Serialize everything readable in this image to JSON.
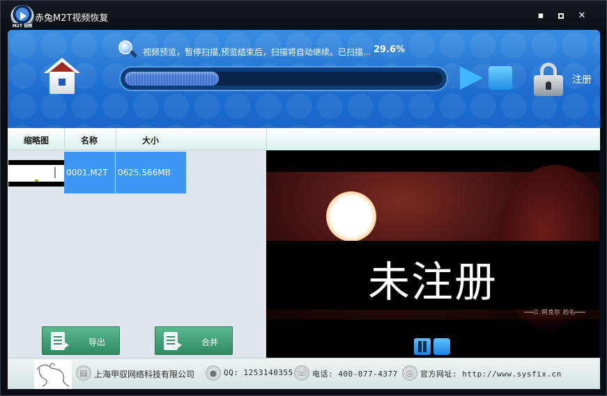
{
  "window": {
    "title": "赤兔M2T视频恢复",
    "logo_badge": "M2T 视频",
    "controls": {
      "minimize": "▪",
      "maximize": "",
      "close": "✕"
    }
  },
  "header": {
    "status_text": "视频预览，暂停扫描,预览结束后，扫描将自动继续。已扫描...",
    "progress_percent_label": "29.6%",
    "progress_fraction": 0.296,
    "register_label": "注册",
    "icons": [
      "home-icon",
      "search-icon",
      "play-icon",
      "stop-icon",
      "lock-icon"
    ],
    "colors": {
      "header_top": "#3b8fe2",
      "header_bottom": "#1766c8",
      "progress_fill": "#5b8ae0",
      "accent": "#3fb6ff"
    }
  },
  "file_list": {
    "columns": [
      "缩略图",
      "名称",
      "大小"
    ],
    "rows": [
      {
        "name": "0001.M2T",
        "size": "0625.566MB",
        "selected": true
      }
    ],
    "selected_color": "#3d98f4"
  },
  "actions": {
    "export_label": "导出",
    "merge_label": "合并"
  },
  "preview": {
    "overlay_text": "未注册",
    "caption": "三.阿克尔 约礼"
  },
  "footer": {
    "company": "上海甲驭网络科技有限公司",
    "qq": "QQ: 1253140355",
    "phone": "电话: 400-077-4377",
    "website": "官方网址: http://www.sysfix.cn",
    "icons": [
      "building-icon",
      "qq-icon",
      "phone-icon",
      "globe-icon"
    ]
  }
}
